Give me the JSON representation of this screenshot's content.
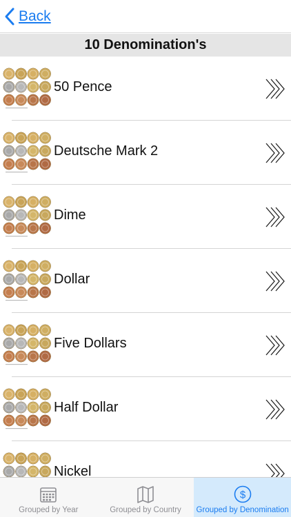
{
  "nav": {
    "back_label": "Back",
    "back_icon": "chevron-left-icon"
  },
  "header": {
    "title": "10 Denomination's"
  },
  "list": {
    "items": [
      {
        "label": "50 Pence",
        "icon": "coins-thumbnail"
      },
      {
        "label": "Deutsche Mark 2",
        "icon": "coins-thumbnail"
      },
      {
        "label": "Dime",
        "icon": "coins-thumbnail"
      },
      {
        "label": "Dollar",
        "icon": "coins-thumbnail"
      },
      {
        "label": "Five Dollars",
        "icon": "coins-thumbnail"
      },
      {
        "label": "Half Dollar",
        "icon": "coins-thumbnail"
      },
      {
        "label": "Nickel",
        "icon": "coins-thumbnail"
      }
    ]
  },
  "tabs": [
    {
      "label": "Grouped by Year",
      "icon": "calendar-icon",
      "active": false
    },
    {
      "label": "Grouped by Country",
      "icon": "map-icon",
      "active": false
    },
    {
      "label": "Grouped by Denomination",
      "icon": "dollar-circle-icon",
      "active": true
    }
  ],
  "colors": {
    "accent": "#1a7cf0",
    "tab_active_bg": "#d4eafc",
    "header_bg": "#e5e5e5",
    "inactive_tab": "#8e8e93"
  }
}
